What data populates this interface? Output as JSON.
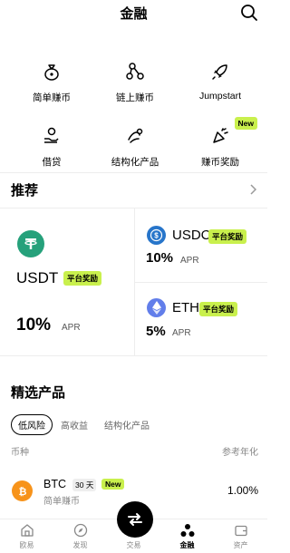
{
  "header": {
    "title": "金融"
  },
  "features": [
    {
      "label": "简单赚币",
      "icon": "money-bag-icon"
    },
    {
      "label": "链上赚币",
      "icon": "chain-nodes-icon"
    },
    {
      "label": "Jumpstart",
      "icon": "rocket-icon"
    },
    {
      "label": "借贷",
      "icon": "coins-hand-icon"
    },
    {
      "label": "结构化产品",
      "icon": "structured-product-icon"
    },
    {
      "label": "赚币奖励",
      "icon": "party-popper-icon",
      "badge": "New"
    }
  ],
  "recommend": {
    "title": "推荐",
    "featured": {
      "coin": "USDT",
      "tag": "平台奖励",
      "apr": "10%",
      "apr_label": "APR"
    },
    "items": [
      {
        "coin": "USDC",
        "tag": "平台奖励",
        "apr": "10%",
        "apr_label": "APR"
      },
      {
        "coin": "ETH",
        "tag": "平台奖励",
        "apr": "5%",
        "apr_label": "APR"
      }
    ]
  },
  "selected": {
    "title": "精选产品",
    "filters": [
      "低风险",
      "高收益",
      "结构化产品"
    ],
    "active_filter": "低风险",
    "columns": {
      "coin": "币种",
      "rate": "参考年化"
    },
    "rows": [
      {
        "coin": "BTC",
        "days": "30 天",
        "badge": "New",
        "sub": "简单赚币",
        "rate": "1.00%"
      }
    ]
  },
  "tabbar": [
    {
      "label": "欧易",
      "icon": "home-icon"
    },
    {
      "label": "发现",
      "icon": "discover-icon"
    },
    {
      "label": "交易",
      "icon": "trade-swap-icon"
    },
    {
      "label": "金融",
      "icon": "finance-icon",
      "active": true
    },
    {
      "label": "资产",
      "icon": "wallet-icon"
    }
  ],
  "colors": {
    "accent_tag": "#c9f04d",
    "usdt": "#26a17b",
    "usdc": "#2775ca",
    "eth": "#627eea",
    "btc": "#f7931a"
  }
}
